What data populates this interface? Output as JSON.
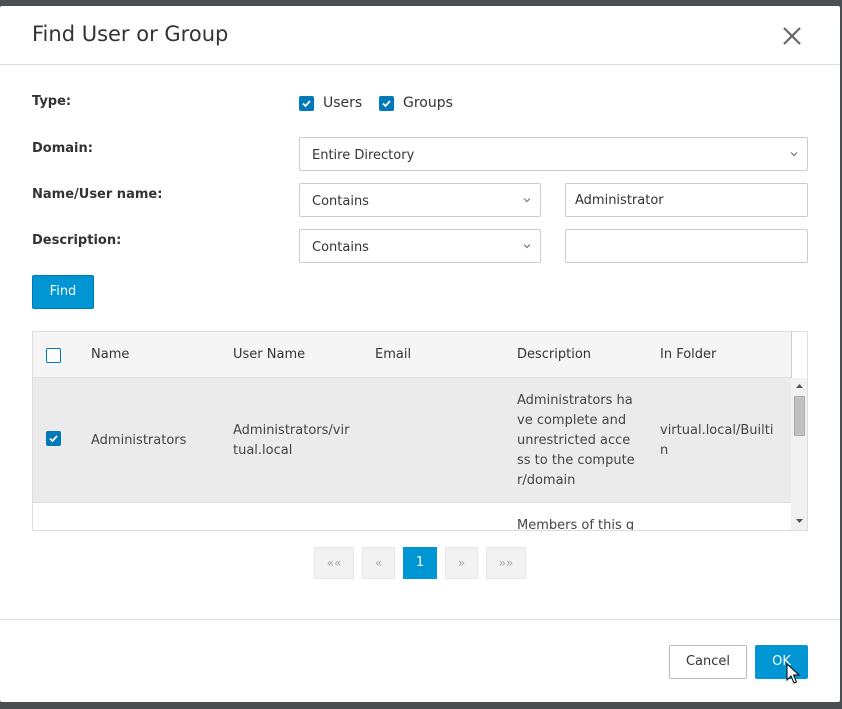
{
  "dialog": {
    "title": "Find User or Group"
  },
  "form": {
    "type_label": "Type:",
    "type_users": "Users",
    "type_users_checked": true,
    "type_groups": "Groups",
    "type_groups_checked": true,
    "domain_label": "Domain:",
    "domain_value": "Entire Directory",
    "name_label": "Name/User name:",
    "name_operator": "Contains",
    "name_value": "Administrator",
    "description_label": "Description:",
    "description_operator": "Contains",
    "description_value": "",
    "find_label": "Find"
  },
  "grid": {
    "columns": [
      "Name",
      "User Name",
      "Email",
      "Description",
      "In Folder"
    ],
    "rows": [
      {
        "selected": true,
        "name": "Administrators",
        "user_name_lines": [
          "Administrators/vir",
          "tual.local"
        ],
        "email": "",
        "description_lines": [
          "Administrators ha",
          "ve complete and",
          "unrestricted acce",
          "ss to the compute",
          "r/domain"
        ],
        "folder_lines": [
          "virtual.local/Builti",
          "n"
        ]
      },
      {
        "selected": false,
        "name": "",
        "user_name_lines": [],
        "email": "",
        "description_lines": [
          "Members of this g"
        ],
        "folder_lines": []
      }
    ]
  },
  "pager": {
    "first": "««",
    "prev": "«",
    "current": "1",
    "next": "»",
    "last": "»»"
  },
  "footer": {
    "cancel_label": "Cancel",
    "ok_label": "OK"
  },
  "colors": {
    "accent": "#0095d3",
    "checkbox": "#0079b8"
  }
}
